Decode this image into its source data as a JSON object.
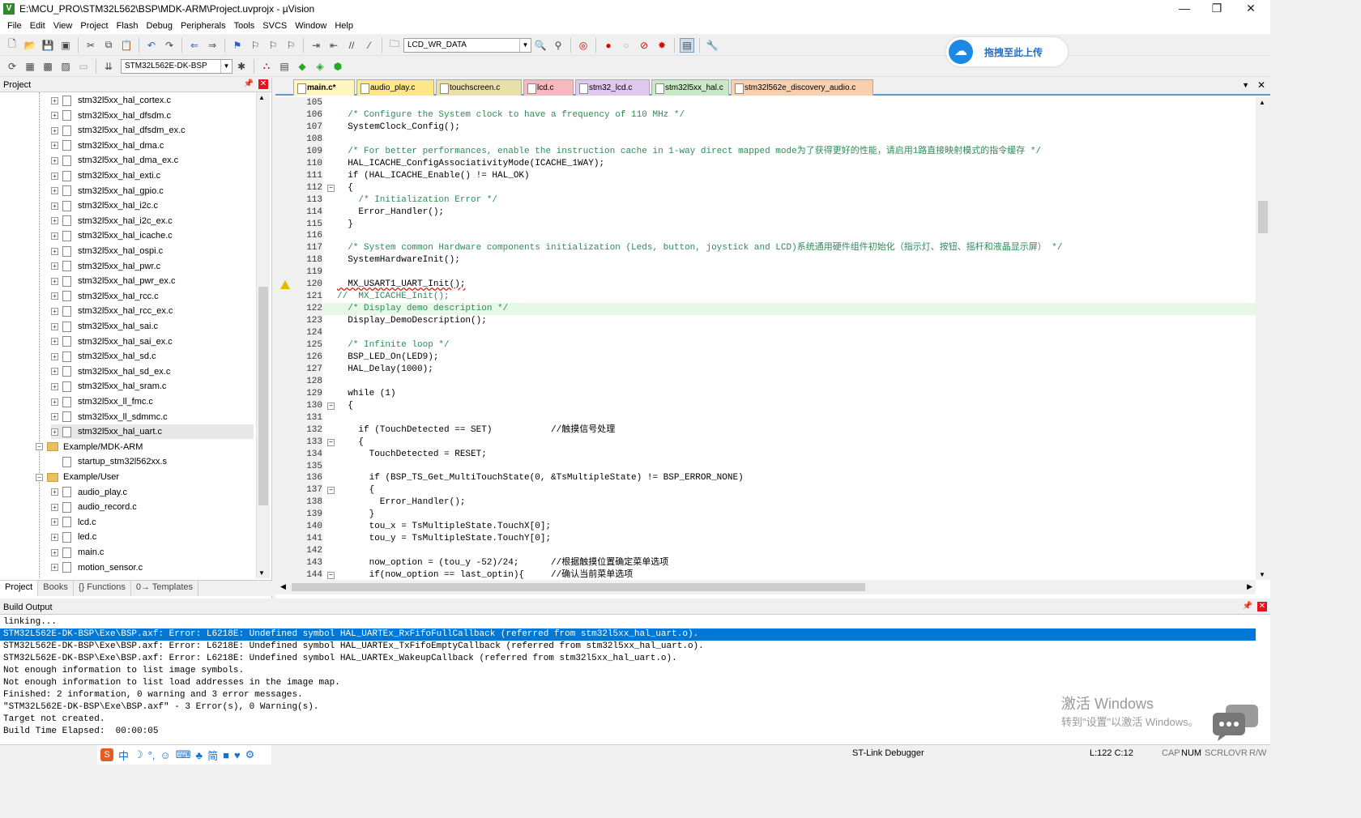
{
  "window": {
    "title": "E:\\MCU_PRO\\STM32L562\\BSP\\MDK-ARM\\Project.uvprojx - µVision",
    "app_icon": "V",
    "min": "—",
    "max": "❐",
    "close": "✕"
  },
  "menu": [
    "File",
    "Edit",
    "View",
    "Project",
    "Flash",
    "Debug",
    "Peripherals",
    "Tools",
    "SVCS",
    "Window",
    "Help"
  ],
  "toolbar": {
    "find_combo": "LCD_WR_DATA",
    "target_combo": "STM32L562E-DK-BSP"
  },
  "upload": {
    "label": "拖拽至此上传"
  },
  "project_panel": {
    "title": "Project",
    "pin": "📌",
    "close": "✕",
    "tree": [
      {
        "label": "stm32l5xx_hal_cortex.c",
        "level": 2,
        "kind": "file"
      },
      {
        "label": "stm32l5xx_hal_dfsdm.c",
        "level": 2,
        "kind": "file"
      },
      {
        "label": "stm32l5xx_hal_dfsdm_ex.c",
        "level": 2,
        "kind": "file"
      },
      {
        "label": "stm32l5xx_hal_dma.c",
        "level": 2,
        "kind": "file"
      },
      {
        "label": "stm32l5xx_hal_dma_ex.c",
        "level": 2,
        "kind": "file"
      },
      {
        "label": "stm32l5xx_hal_exti.c",
        "level": 2,
        "kind": "file"
      },
      {
        "label": "stm32l5xx_hal_gpio.c",
        "level": 2,
        "kind": "file"
      },
      {
        "label": "stm32l5xx_hal_i2c.c",
        "level": 2,
        "kind": "file"
      },
      {
        "label": "stm32l5xx_hal_i2c_ex.c",
        "level": 2,
        "kind": "file"
      },
      {
        "label": "stm32l5xx_hal_icache.c",
        "level": 2,
        "kind": "file"
      },
      {
        "label": "stm32l5xx_hal_ospi.c",
        "level": 2,
        "kind": "file"
      },
      {
        "label": "stm32l5xx_hal_pwr.c",
        "level": 2,
        "kind": "file"
      },
      {
        "label": "stm32l5xx_hal_pwr_ex.c",
        "level": 2,
        "kind": "file"
      },
      {
        "label": "stm32l5xx_hal_rcc.c",
        "level": 2,
        "kind": "file"
      },
      {
        "label": "stm32l5xx_hal_rcc_ex.c",
        "level": 2,
        "kind": "file"
      },
      {
        "label": "stm32l5xx_hal_sai.c",
        "level": 2,
        "kind": "file"
      },
      {
        "label": "stm32l5xx_hal_sai_ex.c",
        "level": 2,
        "kind": "file"
      },
      {
        "label": "stm32l5xx_hal_sd.c",
        "level": 2,
        "kind": "file"
      },
      {
        "label": "stm32l5xx_hal_sd_ex.c",
        "level": 2,
        "kind": "file"
      },
      {
        "label": "stm32l5xx_hal_sram.c",
        "level": 2,
        "kind": "file"
      },
      {
        "label": "stm32l5xx_ll_fmc.c",
        "level": 2,
        "kind": "file"
      },
      {
        "label": "stm32l5xx_ll_sdmmc.c",
        "level": 2,
        "kind": "file"
      },
      {
        "label": "stm32l5xx_hal_uart.c",
        "level": 2,
        "kind": "file",
        "selected": true
      },
      {
        "label": "Example/MDK-ARM",
        "level": 1,
        "kind": "folder"
      },
      {
        "label": "startup_stm32l562xx.s",
        "level": 2,
        "kind": "file",
        "noplus": true
      },
      {
        "label": "Example/User",
        "level": 1,
        "kind": "folder"
      },
      {
        "label": "audio_play.c",
        "level": 2,
        "kind": "file"
      },
      {
        "label": "audio_record.c",
        "level": 2,
        "kind": "file"
      },
      {
        "label": "lcd.c",
        "level": 2,
        "kind": "file"
      },
      {
        "label": "led.c",
        "level": 2,
        "kind": "file"
      },
      {
        "label": "main.c",
        "level": 2,
        "kind": "file"
      },
      {
        "label": "motion_sensor.c",
        "level": 2,
        "kind": "file"
      }
    ],
    "tabs": [
      "Project",
      "Books",
      "{} Functions",
      "0→ Templates"
    ]
  },
  "editor": {
    "tabs": [
      {
        "label": "main.c*",
        "color": "#ffe88a",
        "active": true
      },
      {
        "label": "audio_play.c",
        "color": "#ffe88a"
      },
      {
        "label": "touchscreen.c",
        "color": "#e8e0a8"
      },
      {
        "label": "lcd.c",
        "color": "#f8b8c0"
      },
      {
        "label": "stm32_lcd.c",
        "color": "#e0c8f0"
      },
      {
        "label": "stm32l5xx_hal.c",
        "color": "#c8e8c8"
      },
      {
        "label": "stm32l562e_discovery_audio.c",
        "color": "#f8d0b0"
      }
    ],
    "lines": [
      {
        "n": "105",
        "t": ""
      },
      {
        "n": "106",
        "t": "  /* Configure the System clock to have a frequency of 110 MHz */",
        "c": "cm"
      },
      {
        "n": "107",
        "t": "  SystemClock_Config();"
      },
      {
        "n": "108",
        "t": ""
      },
      {
        "n": "109",
        "t": "  /* For better performances, enable the instruction cache in 1-way direct mapped mode为了获得更好的性能，请启用1路直接映射模式的指令缓存 */",
        "c": "cm"
      },
      {
        "n": "110",
        "t": "  HAL_ICACHE_ConfigAssociativityMode(ICACHE_1WAY);"
      },
      {
        "n": "111",
        "t": "  if (HAL_ICACHE_Enable() != HAL_OK)"
      },
      {
        "n": "112",
        "t": "  {",
        "fold": true
      },
      {
        "n": "113",
        "t": "    /* Initialization Error */",
        "c": "cm"
      },
      {
        "n": "114",
        "t": "    Error_Handler();"
      },
      {
        "n": "115",
        "t": "  }"
      },
      {
        "n": "116",
        "t": ""
      },
      {
        "n": "117",
        "t": "  /* System common Hardware components initialization (Leds, button, joystick and LCD)系统通用硬件组件初始化（指示灯、按钮、摇杆和液晶显示屏） */",
        "c": "cm"
      },
      {
        "n": "118",
        "t": "  SystemHardwareInit();"
      },
      {
        "n": "119",
        "t": ""
      },
      {
        "n": "120",
        "t": "  MX_USART1_UART_Init();",
        "warn": true
      },
      {
        "n": "121",
        "t": "//  MX_ICACHE_Init();",
        "c": "cm"
      },
      {
        "n": "122",
        "t": "  /* Display demo description */",
        "c": "cm",
        "hl": true
      },
      {
        "n": "123",
        "t": "  Display_DemoDescription();"
      },
      {
        "n": "124",
        "t": ""
      },
      {
        "n": "125",
        "t": "  /* Infinite loop */",
        "c": "cm"
      },
      {
        "n": "126",
        "t": "  BSP_LED_On(LED9);"
      },
      {
        "n": "127",
        "t": "  HAL_Delay(1000);"
      },
      {
        "n": "128",
        "t": ""
      },
      {
        "n": "129",
        "t": "  while (1)"
      },
      {
        "n": "130",
        "t": "  {",
        "fold": true
      },
      {
        "n": "131",
        "t": ""
      },
      {
        "n": "132",
        "t": "    if (TouchDetected == SET)           //触摸信号处理"
      },
      {
        "n": "133",
        "t": "    {",
        "fold": true
      },
      {
        "n": "134",
        "t": "      TouchDetected = RESET;"
      },
      {
        "n": "135",
        "t": ""
      },
      {
        "n": "136",
        "t": "      if (BSP_TS_Get_MultiTouchState(0, &TsMultipleState) != BSP_ERROR_NONE)"
      },
      {
        "n": "137",
        "t": "      {",
        "fold": true
      },
      {
        "n": "138",
        "t": "        Error_Handler();"
      },
      {
        "n": "139",
        "t": "      }"
      },
      {
        "n": "140",
        "t": "      tou_x = TsMultipleState.TouchX[0];"
      },
      {
        "n": "141",
        "t": "      tou_y = TsMultipleState.TouchY[0];"
      },
      {
        "n": "142",
        "t": ""
      },
      {
        "n": "143",
        "t": "      now_option = (tou_y -52)/24;      //根据触摸位置确定菜单选项"
      },
      {
        "n": "144",
        "t": "      if(now_option == last_optin){     //确认当前菜单选项",
        "fold": true
      }
    ]
  },
  "build": {
    "title": "Build Output",
    "pin": "📌",
    "close": "✕",
    "lines": [
      {
        "t": "linking..."
      },
      {
        "t": "STM32L562E-DK-BSP\\Exe\\BSP.axf: Error: L6218E: Undefined symbol HAL_UARTEx_RxFifoFullCallback (referred from stm32l5xx_hal_uart.o).",
        "sel": true
      },
      {
        "t": "STM32L562E-DK-BSP\\Exe\\BSP.axf: Error: L6218E: Undefined symbol HAL_UARTEx_TxFifoEmptyCallback (referred from stm32l5xx_hal_uart.o)."
      },
      {
        "t": "STM32L562E-DK-BSP\\Exe\\BSP.axf: Error: L6218E: Undefined symbol HAL_UARTEx_WakeupCallback (referred from stm32l5xx_hal_uart.o)."
      },
      {
        "t": "Not enough information to list image symbols."
      },
      {
        "t": "Not enough information to list load addresses in the image map."
      },
      {
        "t": "Finished: 2 information, 0 warning and 3 error messages."
      },
      {
        "t": "\"STM32L562E-DK-BSP\\Exe\\BSP.axf\" - 3 Error(s), 0 Warning(s)."
      },
      {
        "t": "Target not created."
      },
      {
        "t": "Build Time Elapsed:  00:00:05"
      }
    ]
  },
  "watermark": {
    "line1": "激活 Windows",
    "line2": "转到\"设置\"以激活 Windows。"
  },
  "statusbar": {
    "debugger": "ST-Link Debugger",
    "position": "L:122 C:12",
    "cap": "CAP",
    "num": "NUM",
    "scrl": "SCRL",
    "ovr": "OVR",
    "rw": "R/W",
    "ime_items": [
      "中",
      "☽",
      "°,",
      "☺",
      "⌨",
      "♣",
      "简",
      "■",
      "♥",
      "⚙"
    ]
  }
}
